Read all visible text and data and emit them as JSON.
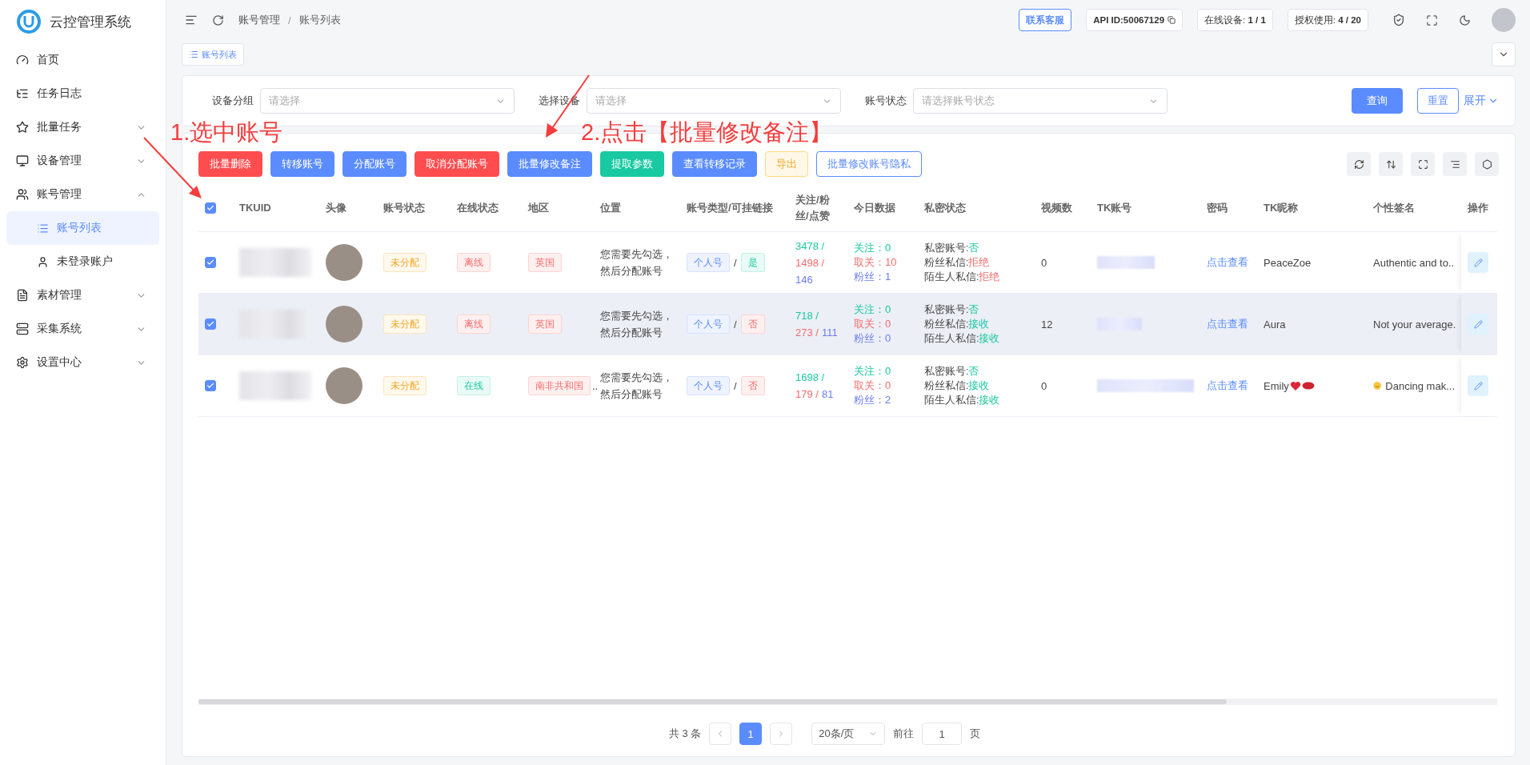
{
  "app": {
    "title": "云控管理系统"
  },
  "sidebar": {
    "items": [
      {
        "label": "首页",
        "kind": "link",
        "selected": false
      },
      {
        "label": "任务日志",
        "kind": "link",
        "selected": false
      },
      {
        "label": "批量任务",
        "kind": "group",
        "expanded": false,
        "selected": false
      },
      {
        "label": "设备管理",
        "kind": "group",
        "expanded": false,
        "selected": false
      },
      {
        "label": "账号管理",
        "kind": "group",
        "expanded": true,
        "selected": false,
        "children": [
          {
            "label": "账号列表",
            "selected": true
          },
          {
            "label": "未登录账户",
            "selected": false
          }
        ]
      },
      {
        "label": "素材管理",
        "kind": "group",
        "expanded": false,
        "selected": false
      },
      {
        "label": "采集系统",
        "kind": "group",
        "expanded": false,
        "selected": false
      },
      {
        "label": "设置中心",
        "kind": "group",
        "expanded": false,
        "selected": false
      }
    ]
  },
  "header": {
    "breadcrumb": [
      "账号管理",
      "账号列表"
    ],
    "breadcrumb_separator": "/",
    "contact": "联系客服",
    "api_id": "API ID:50067129",
    "online_devices": "在线设备: **1 / 1**",
    "license": "授权使用: **4 / 20**"
  },
  "tabs": [
    {
      "label": "账号列表",
      "selected": true
    }
  ],
  "filters": [
    {
      "label": "设备分组",
      "placeholder": "请选择"
    },
    {
      "label": "选择设备",
      "placeholder": "请选择"
    },
    {
      "label": "账号状态",
      "placeholder": "请选择账号状态"
    }
  ],
  "filter_actions": {
    "query": "查询",
    "reset": "重置",
    "expand": "展开"
  },
  "toolbar": [
    {
      "label": "批量删除",
      "kind": "danger"
    },
    {
      "label": "转移账号",
      "kind": "primary"
    },
    {
      "label": "分配账号",
      "kind": "primary"
    },
    {
      "label": "取消分配账号",
      "kind": "danger"
    },
    {
      "label": "批量修改备注",
      "kind": "primary"
    },
    {
      "label": "提取参数",
      "kind": "success"
    },
    {
      "label": "查看转移记录",
      "kind": "primary"
    },
    {
      "label": "导出",
      "kind": "warning"
    },
    {
      "label": "批量修改账号隐私",
      "kind": "outline"
    }
  ],
  "table": {
    "header_checked": true,
    "columns": [
      "TKUID",
      "头像",
      "账号状态",
      "在线状态",
      "地区",
      "位置",
      "账号类型/可挂链接",
      "关注/粉丝/点赞",
      "今日数据",
      "私密状态",
      "视频数",
      "TK账号",
      "密码",
      "TK昵称",
      "个性签名",
      "操作"
    ],
    "rows": [
      {
        "selected": true,
        "hovered": false,
        "account_status": "未分配",
        "online": {
          "text": "离线",
          "kind": "offline"
        },
        "region": "英国",
        "location": "您需要先勾选，然后分配账号",
        "type": "个人号",
        "type_separator": "/",
        "link": {
          "text": "是",
          "kind": "yes"
        },
        "stats": [
          "3478 /",
          "1498 /",
          "146"
        ],
        "today": [
          "关注：0",
          "取关：10",
          "粉丝：1"
        ],
        "privacy": [
          {
            "label": "私密账号:",
            "value": "否",
            "kind": "ok"
          },
          {
            "label": "粉丝私信:",
            "value": "拒绝",
            "kind": "bad"
          },
          {
            "label": "陌生人私信:",
            "value": "拒绝",
            "kind": "bad"
          }
        ],
        "videos": "0",
        "password": "点击查看",
        "nickname": "PeaceZoe",
        "signature": "Authentic and to.."
      },
      {
        "selected": true,
        "hovered": true,
        "account_status": "未分配",
        "online": {
          "text": "离线",
          "kind": "offline"
        },
        "region": "英国",
        "location": "您需要先勾选，然后分配账号",
        "type": "个人号",
        "type_separator": "/",
        "link": {
          "text": "否",
          "kind": "no"
        },
        "stats": [
          "718 /",
          "273 /",
          "111"
        ],
        "today": [
          "关注：0",
          "取关：0",
          "粉丝：0"
        ],
        "privacy": [
          {
            "label": "私密账号:",
            "value": "否",
            "kind": "ok"
          },
          {
            "label": "粉丝私信:",
            "value": "接收",
            "kind": "ok"
          },
          {
            "label": "陌生人私信:",
            "value": "接收",
            "kind": "ok"
          }
        ],
        "videos": "12",
        "password": "点击查看",
        "nickname": "Aura",
        "signature": "Not your average."
      },
      {
        "selected": true,
        "hovered": false,
        "account_status": "未分配",
        "online": {
          "text": "在线",
          "kind": "online"
        },
        "region": "南非共和国",
        "region_overflow": "..",
        "location": "您需要先勾选，然后分配账号",
        "type": "个人号",
        "type_separator": "/",
        "link": {
          "text": "否",
          "kind": "no"
        },
        "stats": [
          "1698 /",
          "179 /",
          "81"
        ],
        "today": [
          "关注：0",
          "取关：0",
          "粉丝：2"
        ],
        "privacy": [
          {
            "label": "私密账号:",
            "value": "否",
            "kind": "ok"
          },
          {
            "label": "粉丝私信:",
            "value": "接收",
            "kind": "ok"
          },
          {
            "label": "陌生人私信:",
            "value": "接收",
            "kind": "ok"
          }
        ],
        "videos": "0",
        "password": "点击查看",
        "nickname": "Emily",
        "nickname_icons": [
          {
            "kind": "heart"
          },
          {
            "kind": "lips"
          }
        ],
        "signature_icon": {
          "kind": "smile"
        },
        "signature": "Dancing mak..."
      }
    ]
  },
  "pagination": {
    "total": "共 3 条",
    "pages": [
      {
        "label": "1",
        "selected": true
      }
    ],
    "page_size": "20条/页",
    "goto": "前往",
    "goto_value": "1",
    "unit": "页"
  },
  "annotations": [
    {
      "text": "1.选中账号"
    },
    {
      "text": "2.点击【批量修改备注】"
    }
  ]
}
